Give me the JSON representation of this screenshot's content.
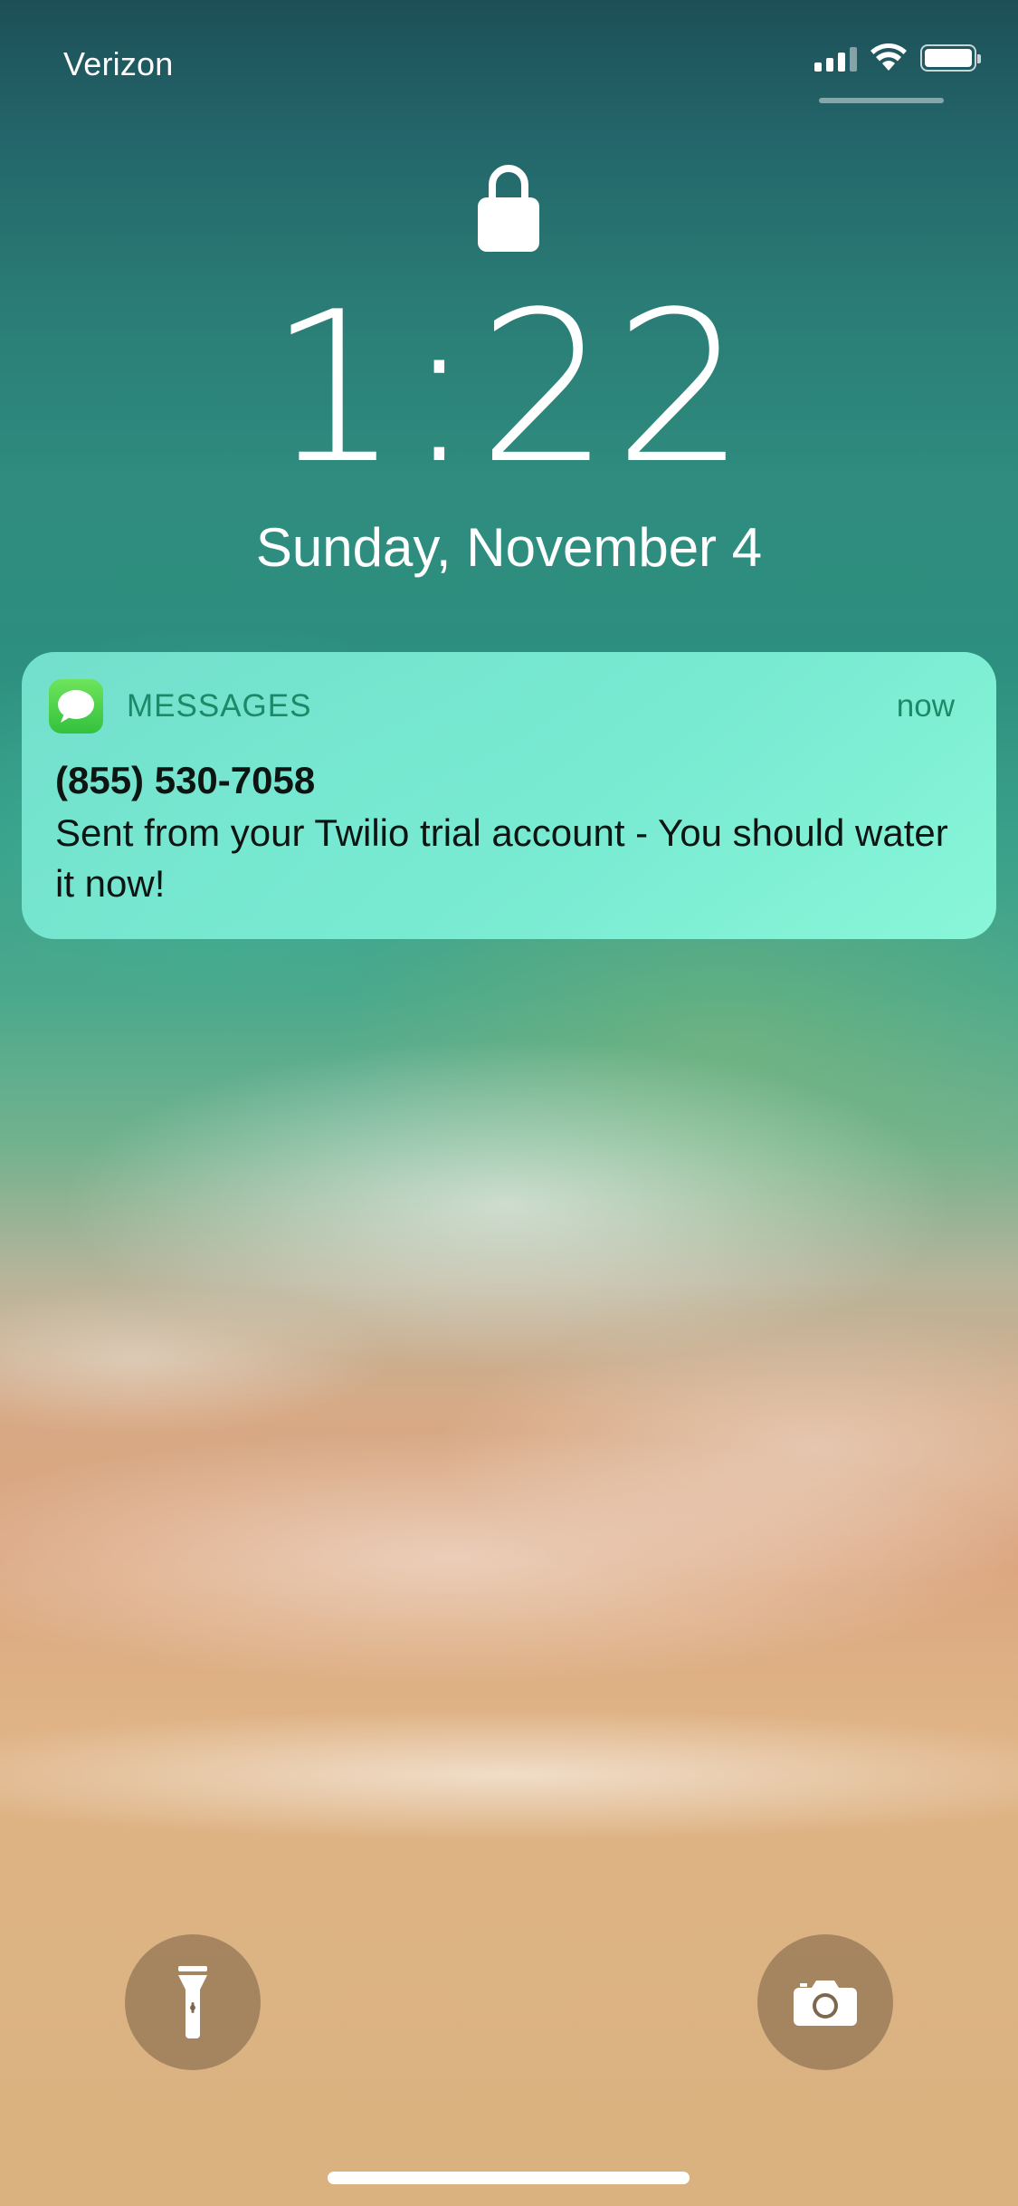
{
  "status_bar": {
    "carrier": "Verizon",
    "signal_bars_active": 3,
    "signal_bars_total": 4,
    "wifi_icon": "wifi-icon",
    "battery_icon": "battery-icon",
    "battery_level": 1.0
  },
  "lock_screen": {
    "lock_icon": "lock-icon",
    "time": "1:22",
    "date": "Sunday, November 4"
  },
  "notification": {
    "app_icon": "messages-app-icon",
    "app_name": "MESSAGES",
    "timestamp": "now",
    "sender": "(855) 530-7058",
    "body": "Sent from your Twilio trial account - You should water it now!"
  },
  "quick_actions": {
    "flashlight_icon": "flashlight-icon",
    "camera_icon": "camera-icon"
  },
  "colors": {
    "notification_bg": "#7fe9d4",
    "app_accent": "#1b8a68",
    "messages_green": "#4cd35a"
  }
}
